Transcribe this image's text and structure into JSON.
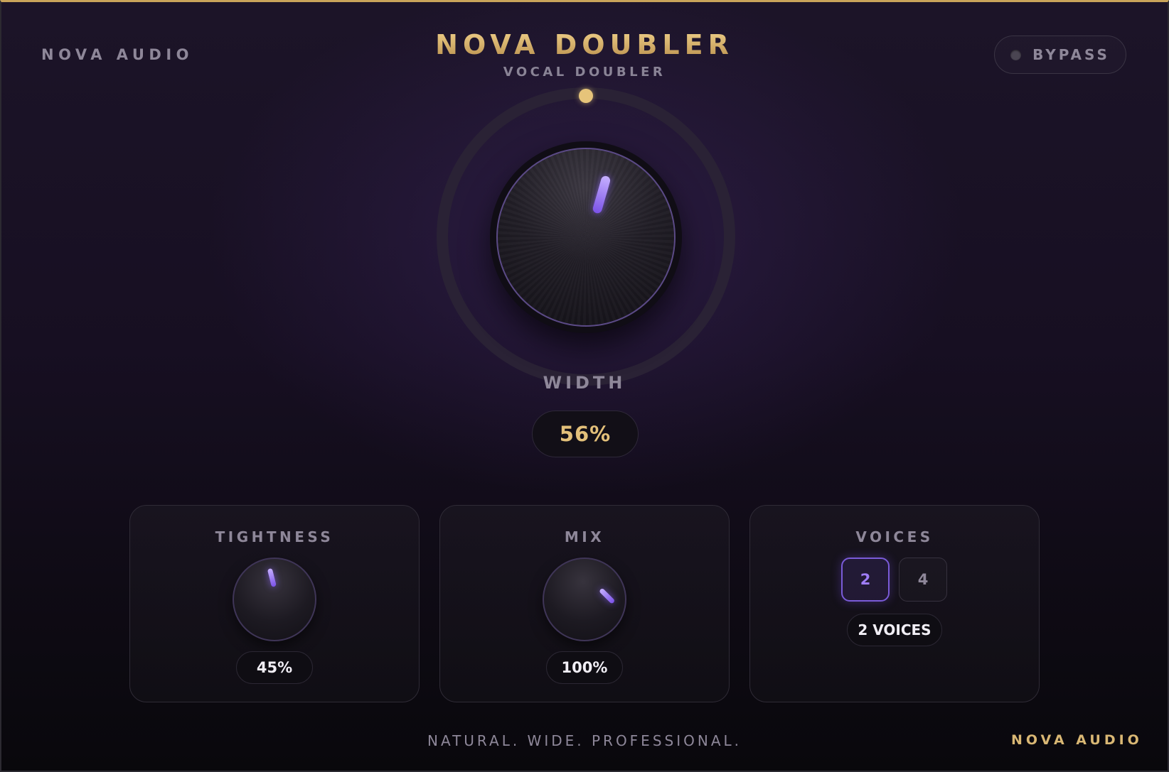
{
  "header": {
    "brand": "NOVA AUDIO",
    "title": "NOVA DOUBLER",
    "subtitle": "VOCAL DOUBLER",
    "bypass_label": "BYPASS",
    "bypass_active": false
  },
  "width": {
    "label": "WIDTH",
    "value_text": "56%",
    "value": 56
  },
  "tightness": {
    "label": "TIGHTNESS",
    "value_text": "45%",
    "value": 45
  },
  "mix": {
    "label": "MIX",
    "value_text": "100%",
    "value": 100
  },
  "voices": {
    "label": "VOICES",
    "options": [
      "2",
      "4"
    ],
    "selected": "2",
    "readout": "2 VOICES"
  },
  "footer": {
    "tagline": "NATURAL. WIDE. PROFESSIONAL.",
    "brand": "NOVA AUDIO"
  },
  "colors": {
    "accent_gold": "#e3c07a",
    "accent_purple": "#8b63f0",
    "background": "#170f22"
  },
  "icons": {
    "bypass": "power-led-icon",
    "knob_pointer": "knob-indicator-icon"
  }
}
